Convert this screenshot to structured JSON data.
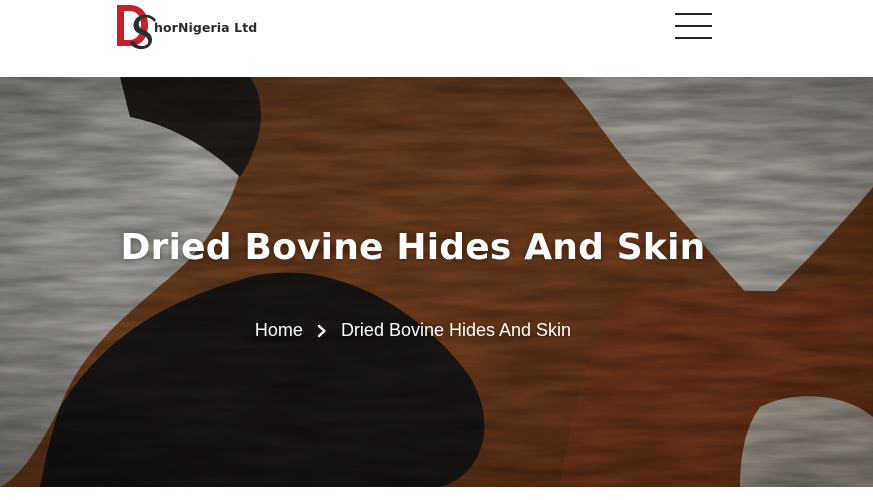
{
  "header": {
    "logo_text": "horNigeria Ltd",
    "logo_letters": "DS",
    "menu_icon": "hamburger-menu-icon"
  },
  "hero": {
    "title": "Dried Bovine Hides And Skin",
    "background_image": "cowhide fur texture (white, black, brown)"
  },
  "breadcrumb": {
    "home": "Home",
    "separator_icon": "chevron-right-icon",
    "current": "Dried Bovine Hides And Skin"
  },
  "colors": {
    "logo_red": "#c8202a",
    "logo_dark": "#2b2b2b",
    "text_light": "#ffffff"
  }
}
